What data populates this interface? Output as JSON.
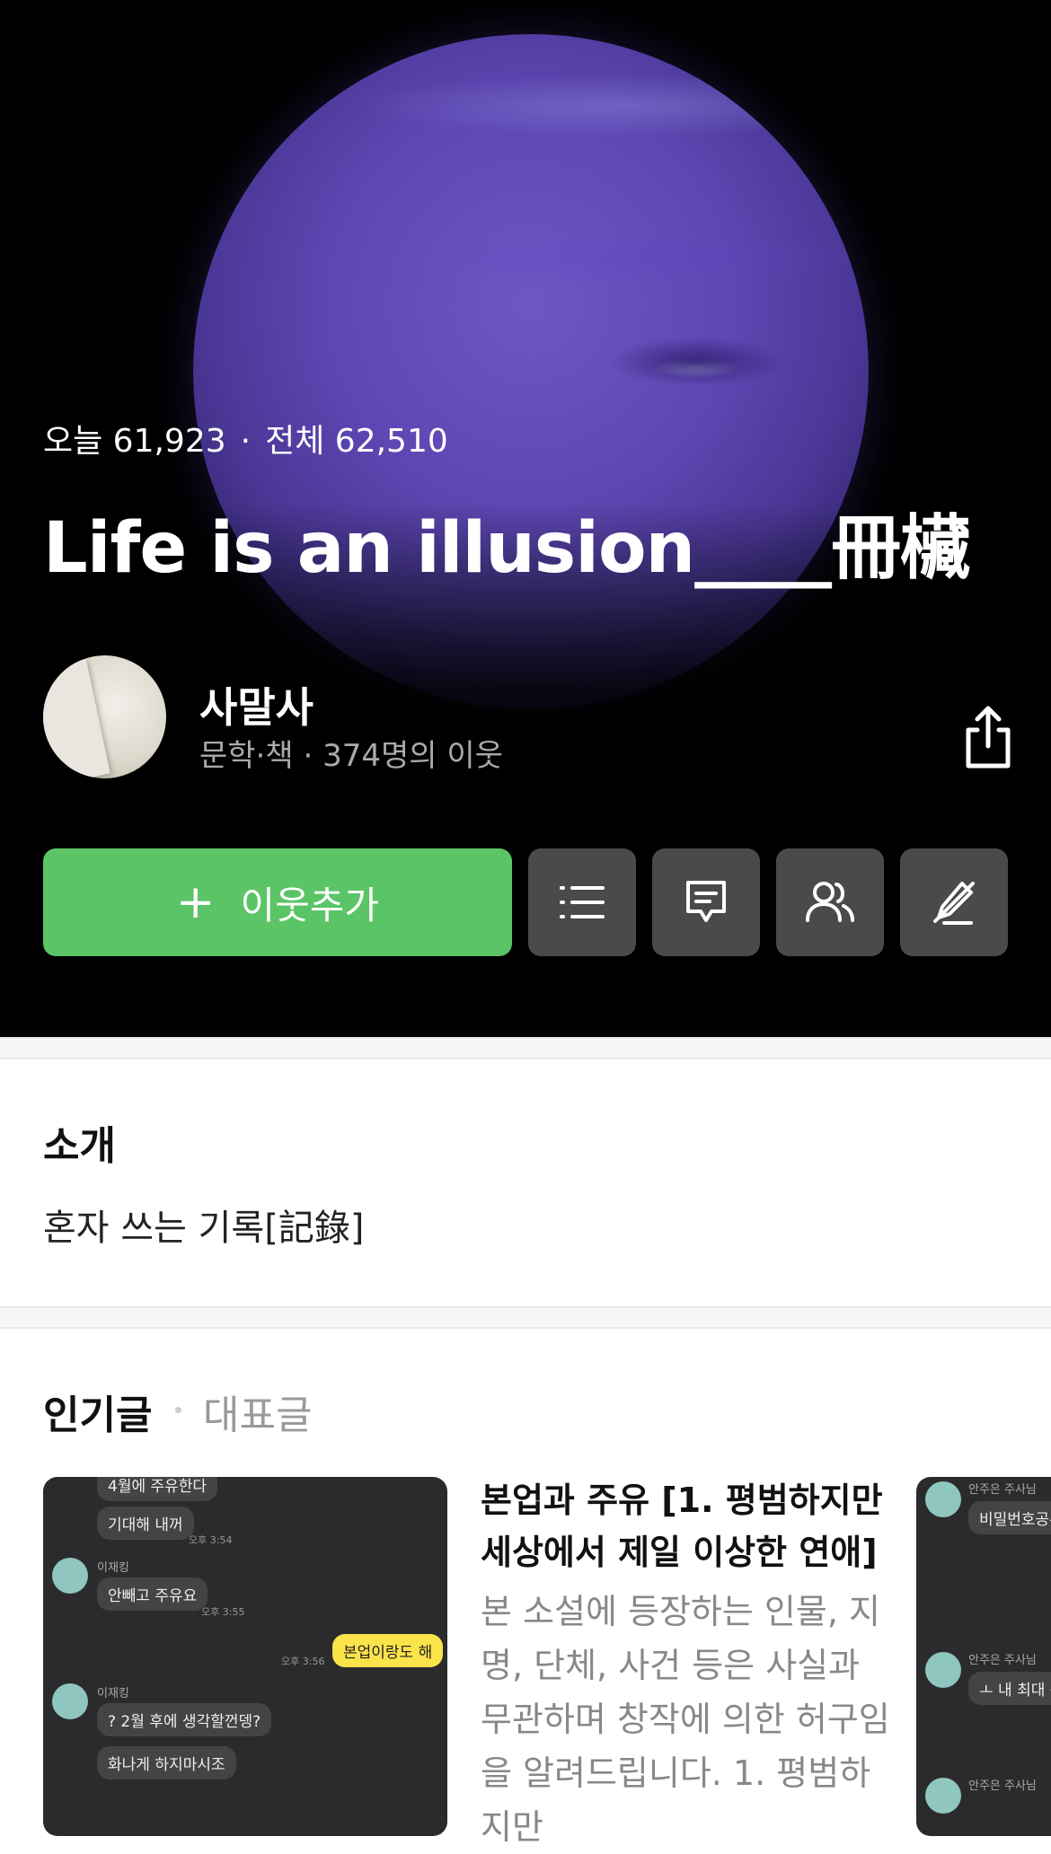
{
  "hero": {
    "stats_today": "오늘 61,923",
    "stats_dot": "·",
    "stats_total": "전체 62,510",
    "title": "Life is an illusion____冊欌"
  },
  "profile": {
    "name": "사말사",
    "meta": "문학·책 · 374명의 이웃"
  },
  "actions": {
    "add_neighbor_icon": "+",
    "add_neighbor_label": "이웃추가",
    "icons": [
      "list-icon",
      "comment-icon",
      "neighbors-icon",
      "edit-off-icon"
    ]
  },
  "intro": {
    "heading": "소개",
    "text": "혼자 쓰는 기록[記錄]"
  },
  "posts_tabs": {
    "active": "인기글",
    "inactive": "대표글"
  },
  "featured_post": {
    "title": "본업과 주유 [1. 평범하지만 세상에서 제일 이상한 연애]",
    "excerpt": "본 소설에 등장하는 인물, 지명, 단체, 사건 등은 사실과 무관하며 창작에 의한 허구임을 알려드립니다. 1. 평범하지만",
    "thumb_chat": {
      "line1": "4월에 주유한다",
      "line2": "기대해 내꺼",
      "time1": "오후 3:54",
      "name1": "이재킹",
      "line3": "안빼고 주유요",
      "time2": "오후 3:55",
      "time3": "오후 3:56",
      "yellow": "본업이랑도 해",
      "name2": "이재킹",
      "line4": "? 2월 후에 생각할껀뎅?",
      "line5": "화나게 하지마시조"
    }
  },
  "next_post_thumb": {
    "name1": "안주은 주사님",
    "line1": "비밀번호공유",
    "name2": "안주은 주사님",
    "line2": "ㅗ 내 최대 관",
    "name3": "안주은 주사님"
  },
  "colors": {
    "accent_green": "#5ac466",
    "hero_bg": "#000000",
    "planet_purple": "#5d47b3"
  }
}
